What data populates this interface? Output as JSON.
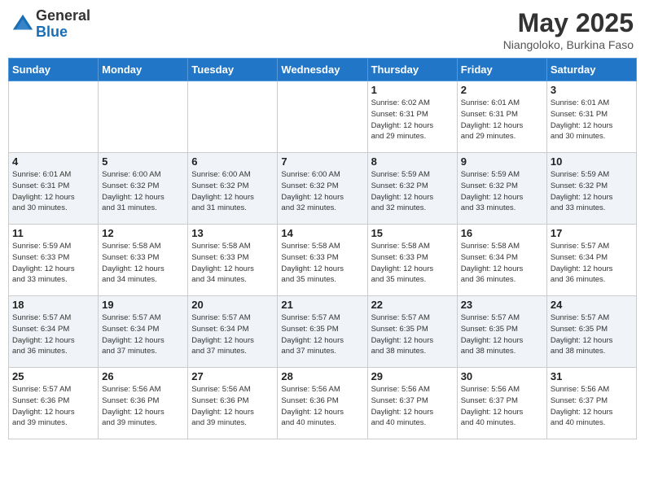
{
  "logo": {
    "general": "General",
    "blue": "Blue"
  },
  "title": {
    "month_year": "May 2025",
    "location": "Niangoloko, Burkina Faso"
  },
  "headers": [
    "Sunday",
    "Monday",
    "Tuesday",
    "Wednesday",
    "Thursday",
    "Friday",
    "Saturday"
  ],
  "weeks": [
    [
      {
        "day": "",
        "info": ""
      },
      {
        "day": "",
        "info": ""
      },
      {
        "day": "",
        "info": ""
      },
      {
        "day": "",
        "info": ""
      },
      {
        "day": "1",
        "info": "Sunrise: 6:02 AM\nSunset: 6:31 PM\nDaylight: 12 hours\nand 29 minutes."
      },
      {
        "day": "2",
        "info": "Sunrise: 6:01 AM\nSunset: 6:31 PM\nDaylight: 12 hours\nand 29 minutes."
      },
      {
        "day": "3",
        "info": "Sunrise: 6:01 AM\nSunset: 6:31 PM\nDaylight: 12 hours\nand 30 minutes."
      }
    ],
    [
      {
        "day": "4",
        "info": "Sunrise: 6:01 AM\nSunset: 6:31 PM\nDaylight: 12 hours\nand 30 minutes."
      },
      {
        "day": "5",
        "info": "Sunrise: 6:00 AM\nSunset: 6:32 PM\nDaylight: 12 hours\nand 31 minutes."
      },
      {
        "day": "6",
        "info": "Sunrise: 6:00 AM\nSunset: 6:32 PM\nDaylight: 12 hours\nand 31 minutes."
      },
      {
        "day": "7",
        "info": "Sunrise: 6:00 AM\nSunset: 6:32 PM\nDaylight: 12 hours\nand 32 minutes."
      },
      {
        "day": "8",
        "info": "Sunrise: 5:59 AM\nSunset: 6:32 PM\nDaylight: 12 hours\nand 32 minutes."
      },
      {
        "day": "9",
        "info": "Sunrise: 5:59 AM\nSunset: 6:32 PM\nDaylight: 12 hours\nand 33 minutes."
      },
      {
        "day": "10",
        "info": "Sunrise: 5:59 AM\nSunset: 6:32 PM\nDaylight: 12 hours\nand 33 minutes."
      }
    ],
    [
      {
        "day": "11",
        "info": "Sunrise: 5:59 AM\nSunset: 6:33 PM\nDaylight: 12 hours\nand 33 minutes."
      },
      {
        "day": "12",
        "info": "Sunrise: 5:58 AM\nSunset: 6:33 PM\nDaylight: 12 hours\nand 34 minutes."
      },
      {
        "day": "13",
        "info": "Sunrise: 5:58 AM\nSunset: 6:33 PM\nDaylight: 12 hours\nand 34 minutes."
      },
      {
        "day": "14",
        "info": "Sunrise: 5:58 AM\nSunset: 6:33 PM\nDaylight: 12 hours\nand 35 minutes."
      },
      {
        "day": "15",
        "info": "Sunrise: 5:58 AM\nSunset: 6:33 PM\nDaylight: 12 hours\nand 35 minutes."
      },
      {
        "day": "16",
        "info": "Sunrise: 5:58 AM\nSunset: 6:34 PM\nDaylight: 12 hours\nand 36 minutes."
      },
      {
        "day": "17",
        "info": "Sunrise: 5:57 AM\nSunset: 6:34 PM\nDaylight: 12 hours\nand 36 minutes."
      }
    ],
    [
      {
        "day": "18",
        "info": "Sunrise: 5:57 AM\nSunset: 6:34 PM\nDaylight: 12 hours\nand 36 minutes."
      },
      {
        "day": "19",
        "info": "Sunrise: 5:57 AM\nSunset: 6:34 PM\nDaylight: 12 hours\nand 37 minutes."
      },
      {
        "day": "20",
        "info": "Sunrise: 5:57 AM\nSunset: 6:34 PM\nDaylight: 12 hours\nand 37 minutes."
      },
      {
        "day": "21",
        "info": "Sunrise: 5:57 AM\nSunset: 6:35 PM\nDaylight: 12 hours\nand 37 minutes."
      },
      {
        "day": "22",
        "info": "Sunrise: 5:57 AM\nSunset: 6:35 PM\nDaylight: 12 hours\nand 38 minutes."
      },
      {
        "day": "23",
        "info": "Sunrise: 5:57 AM\nSunset: 6:35 PM\nDaylight: 12 hours\nand 38 minutes."
      },
      {
        "day": "24",
        "info": "Sunrise: 5:57 AM\nSunset: 6:35 PM\nDaylight: 12 hours\nand 38 minutes."
      }
    ],
    [
      {
        "day": "25",
        "info": "Sunrise: 5:57 AM\nSunset: 6:36 PM\nDaylight: 12 hours\nand 39 minutes."
      },
      {
        "day": "26",
        "info": "Sunrise: 5:56 AM\nSunset: 6:36 PM\nDaylight: 12 hours\nand 39 minutes."
      },
      {
        "day": "27",
        "info": "Sunrise: 5:56 AM\nSunset: 6:36 PM\nDaylight: 12 hours\nand 39 minutes."
      },
      {
        "day": "28",
        "info": "Sunrise: 5:56 AM\nSunset: 6:36 PM\nDaylight: 12 hours\nand 40 minutes."
      },
      {
        "day": "29",
        "info": "Sunrise: 5:56 AM\nSunset: 6:37 PM\nDaylight: 12 hours\nand 40 minutes."
      },
      {
        "day": "30",
        "info": "Sunrise: 5:56 AM\nSunset: 6:37 PM\nDaylight: 12 hours\nand 40 minutes."
      },
      {
        "day": "31",
        "info": "Sunrise: 5:56 AM\nSunset: 6:37 PM\nDaylight: 12 hours\nand 40 minutes."
      }
    ]
  ]
}
